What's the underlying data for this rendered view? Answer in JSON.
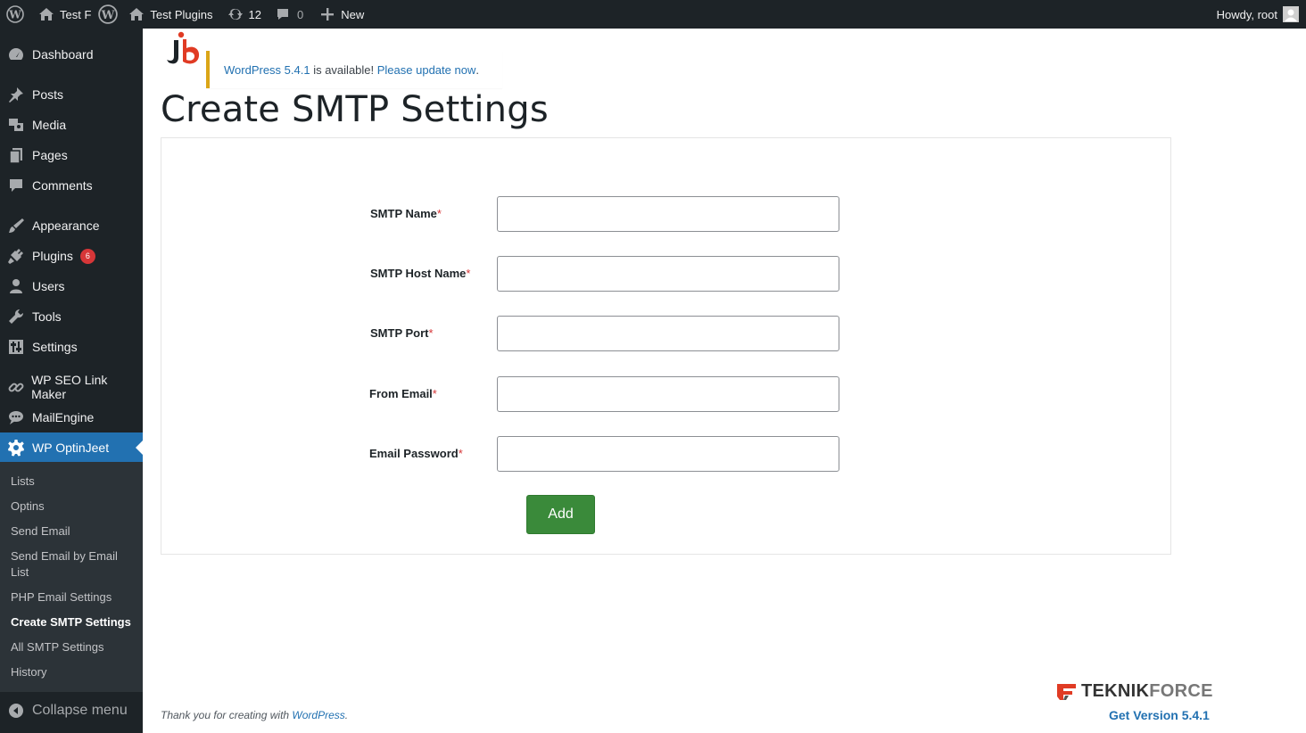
{
  "admin_bar": {
    "site_name_short": "Test F",
    "site_name": "Test Plugins",
    "updates_count": "12",
    "comments_count": "0",
    "new_label": "New",
    "howdy": "Howdy, root"
  },
  "sidebar": {
    "items": [
      {
        "label": "Dashboard",
        "icon": "dashboard-icon"
      },
      {
        "label": "Posts",
        "icon": "pin-icon"
      },
      {
        "label": "Media",
        "icon": "media-icon"
      },
      {
        "label": "Pages",
        "icon": "pages-icon"
      },
      {
        "label": "Comments",
        "icon": "comments-icon"
      },
      {
        "label": "Appearance",
        "icon": "brush-icon"
      },
      {
        "label": "Plugins",
        "icon": "plug-icon",
        "badge": "6"
      },
      {
        "label": "Users",
        "icon": "user-icon"
      },
      {
        "label": "Tools",
        "icon": "wrench-icon"
      },
      {
        "label": "Settings",
        "icon": "sliders-icon"
      },
      {
        "label": "WP SEO Link Maker",
        "icon": "link-icon"
      },
      {
        "label": "MailEngine",
        "icon": "chat-icon"
      },
      {
        "label": "WP OptinJeet",
        "icon": "gear-icon",
        "current": true
      }
    ],
    "submenu": [
      "Lists",
      "Optins",
      "Send Email",
      "Send Email by Email List",
      "PHP Email Settings",
      "Create SMTP Settings",
      "All SMTP Settings",
      "History"
    ],
    "active_submenu": "Create SMTP Settings",
    "collapse_label": "Collapse menu"
  },
  "notice": {
    "version_link": "WordPress 5.4.1",
    "middle_text": " is available! ",
    "update_link": "Please update now",
    "end_text": "."
  },
  "page": {
    "title": "Create SMTP Settings"
  },
  "form": {
    "fields": [
      {
        "label": "SMTP Name",
        "value": ""
      },
      {
        "label": "SMTP Host Name",
        "value": ""
      },
      {
        "label": "SMTP Port",
        "value": ""
      },
      {
        "label": "From Email",
        "value": ""
      },
      {
        "label": "Email Password",
        "value": ""
      }
    ],
    "required_mark": "*",
    "submit_label": "Add"
  },
  "footer": {
    "thanks_prefix": "Thank you for creating with ",
    "thanks_link": "WordPress",
    "thanks_suffix": ".",
    "brand_part1": "TEKNIK",
    "brand_part2": "FORCE",
    "get_version": "Get Version 5.4.1"
  },
  "colors": {
    "admin_bg": "#1d2327",
    "accent": "#2271b1",
    "submenu_bg": "#2c3338",
    "notice_border": "#dba617",
    "add_button": "#3a8a3a",
    "required": "#d63638",
    "brand_red": "#e03b24"
  }
}
